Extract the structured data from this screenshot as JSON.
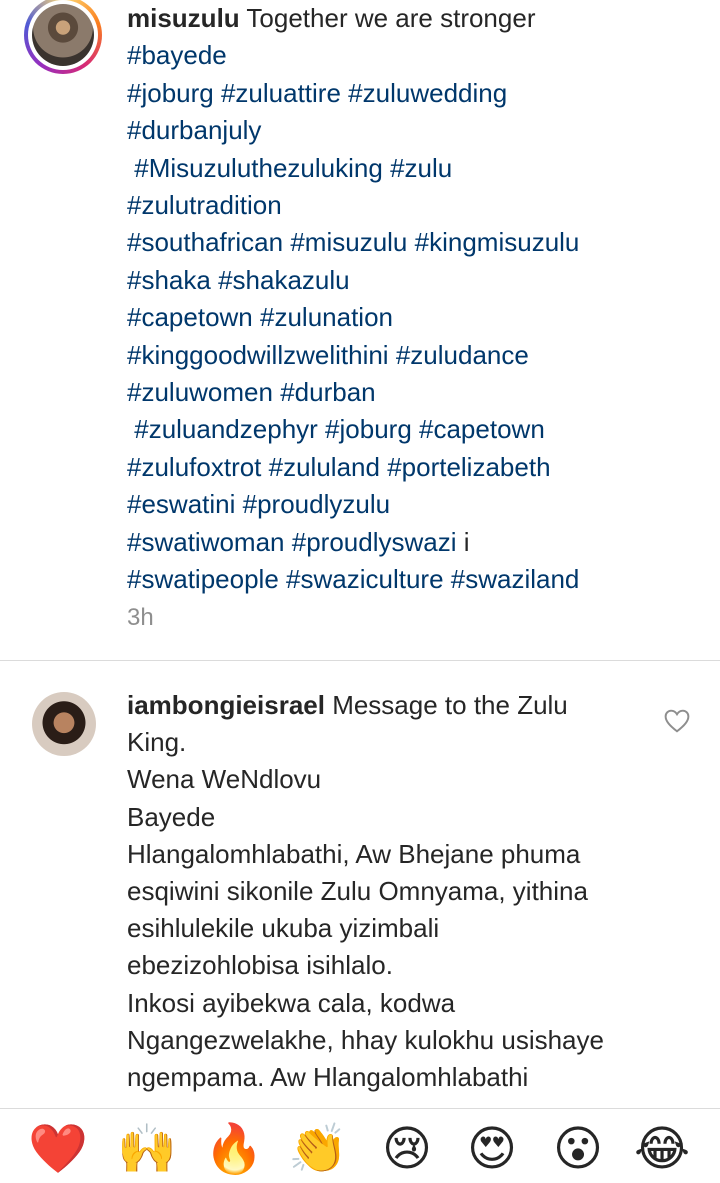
{
  "post": {
    "username": "misuzulu",
    "caption_lines": [
      " Together we are stronger",
      "#bayede",
      "#joburg #zuluattire #zuluwedding",
      "#durbanjuly",
      " #Misuzuluthezuluking #zulu",
      "#zulutradition",
      "#southafrican #misuzulu #kingmisuzulu",
      "#shaka #shakazulu",
      "#capetown #zulunation",
      "#kinggoodwillzwelithini #zuludance",
      "#zuluwomen #durban",
      " #zuluandzephyr #joburg #capetown",
      "#zulufoxtrot #zululand #portelizabeth",
      "#eswatini #proudlyzulu",
      "#swatiwoman #proudlyswazi i",
      "#swatipeople #swaziculture #swaziland"
    ],
    "time": "3h"
  },
  "comment": {
    "username": "iambongieisrael",
    "text_lines": [
      " Message to the Zulu",
      "King.",
      "Wena WeNdlovu",
      "Bayede",
      "Hlangalomhlabathi, Aw Bhejane phuma",
      "esqiwini sikonile Zulu Omnyama, yithina",
      "esihlulekile ukuba yizimbali",
      "ebezizohlobisa isihlalo.",
      "Inkosi ayibekwa cala, kodwa",
      "Ngangezwelakhe, hhay kulokhu usishaye",
      "ngempama. Aw Hlangalomhlabathi"
    ],
    "like_icon": "heart-outline-icon"
  },
  "emoji_bar": {
    "emojis": [
      {
        "name": "red-heart-emoji",
        "char": "❤️"
      },
      {
        "name": "raising-hands-emoji",
        "char": "🙌"
      },
      {
        "name": "fire-emoji",
        "char": "🔥"
      },
      {
        "name": "clapping-hands-emoji",
        "char": "👏"
      },
      {
        "name": "crying-face-emoji",
        "char": "😢"
      },
      {
        "name": "heart-eyes-emoji",
        "char": "😍"
      },
      {
        "name": "surprised-face-emoji",
        "char": "😮"
      },
      {
        "name": "tears-of-joy-emoji",
        "char": "😂"
      }
    ]
  },
  "colors": {
    "hashtag": "#00376b",
    "text": "#262626",
    "muted": "#8e8e8e",
    "divider": "#dbdbdb"
  }
}
